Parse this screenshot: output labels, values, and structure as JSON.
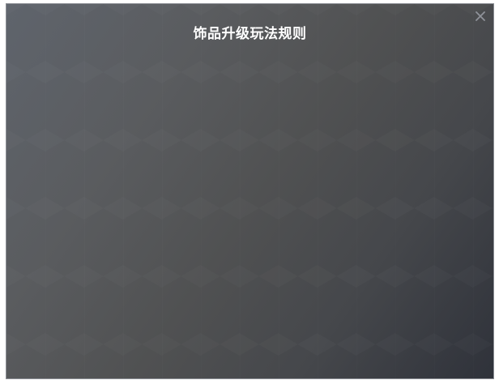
{
  "dialog": {
    "title": "饰品升级玩法规则",
    "close_icon": "close-icon",
    "colors": {
      "title_text": "#ffffff",
      "close_icon": "#8f939a"
    }
  }
}
